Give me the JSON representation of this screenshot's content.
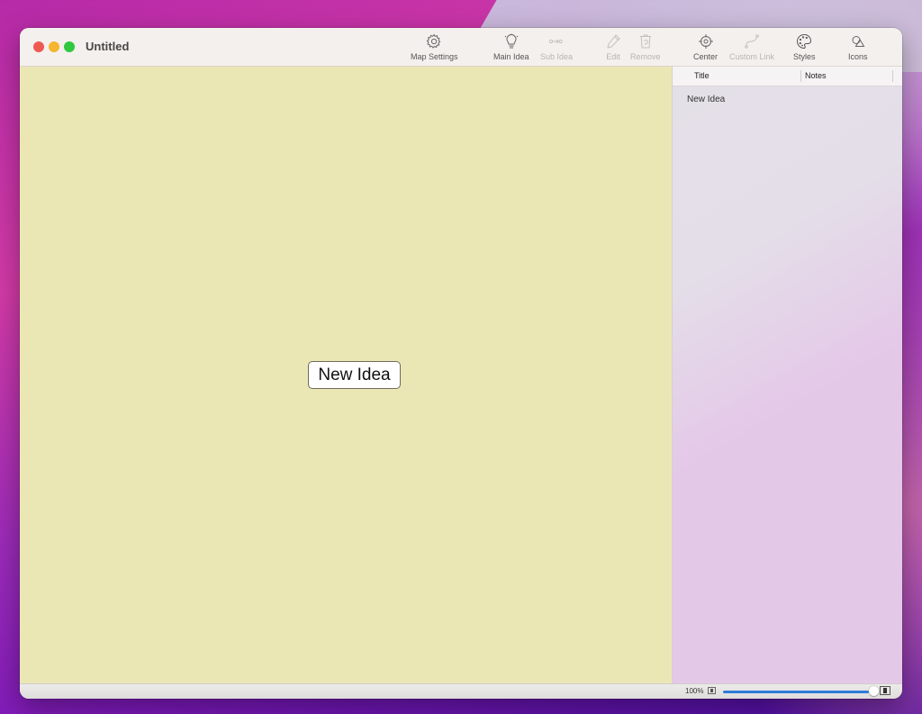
{
  "window": {
    "title": "Untitled"
  },
  "toolbar": {
    "items": [
      {
        "id": "map-settings",
        "label": "Map Settings",
        "icon": "gear-icon",
        "enabled": true
      },
      {
        "id": "main-idea",
        "label": "Main Idea",
        "icon": "lightbulb-icon",
        "enabled": true
      },
      {
        "id": "sub-idea",
        "label": "Sub Idea",
        "icon": "node-link-icon",
        "enabled": false
      },
      {
        "id": "edit",
        "label": "Edit",
        "icon": "pencil-icon",
        "enabled": false
      },
      {
        "id": "remove",
        "label": "Remove",
        "icon": "trash-icon",
        "enabled": false
      },
      {
        "id": "center",
        "label": "Center",
        "icon": "crosshair-icon",
        "enabled": true
      },
      {
        "id": "custom-link",
        "label": "Custom Link",
        "icon": "curve-link-icon",
        "enabled": false
      },
      {
        "id": "styles",
        "label": "Styles",
        "icon": "palette-icon",
        "enabled": true
      },
      {
        "id": "icons",
        "label": "Icons",
        "icon": "shapes-icon",
        "enabled": true
      }
    ]
  },
  "canvas": {
    "background": "#ebe7b5",
    "node": {
      "label": "New Idea"
    }
  },
  "outline": {
    "columns": [
      "Title",
      "Notes"
    ],
    "rows": [
      {
        "title": "New Idea",
        "notes": ""
      }
    ]
  },
  "statusbar": {
    "zoom_label": "100%",
    "zoom_slider_value": 1.0,
    "accent": "#2e7bd8"
  }
}
